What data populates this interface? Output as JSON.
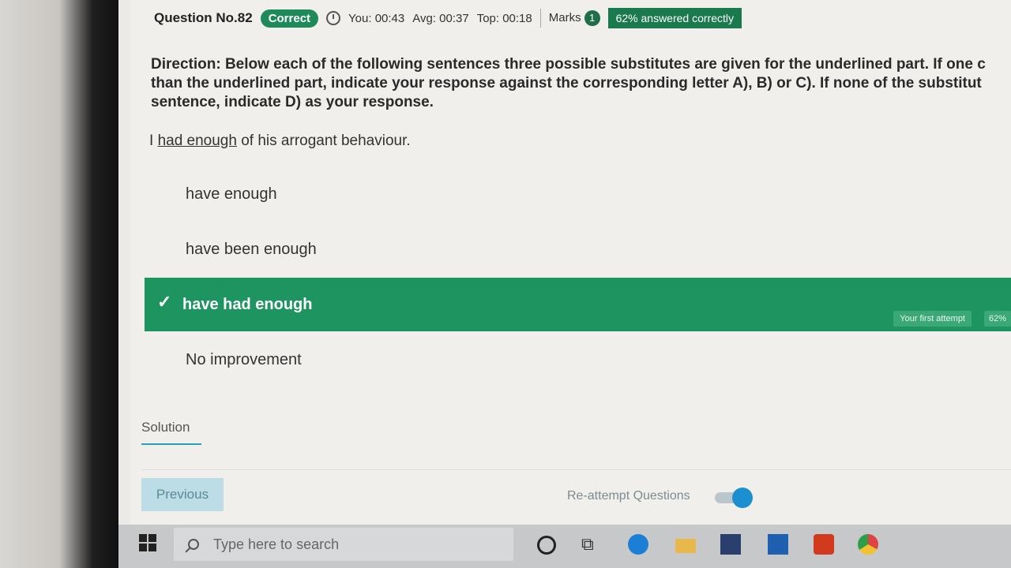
{
  "header": {
    "question_no": "Question No.82",
    "status": "Correct",
    "timing_you": "You: 00:43",
    "timing_avg": "Avg: 00:37",
    "timing_top": "Top: 00:18",
    "marks_label": "Marks",
    "marks_value": "1",
    "answered_pct": "62% answered correctly"
  },
  "question": {
    "direction": "Direction: Below each of the following sentences three possible substitutes are given for the underlined part. If one c",
    "direction_line2": "than the underlined part, indicate your response against the corresponding letter A), B) or C). If none of the substitut",
    "direction_line3": "sentence, indicate D) as your response.",
    "sentence_prefix": "I ",
    "sentence_underlined": "had enough",
    "sentence_suffix": " of his arrogant behaviour."
  },
  "options": [
    {
      "label": "have enough"
    },
    {
      "label": "have been enough"
    },
    {
      "label": "have had enough",
      "first_attempt_tag": "Your first attempt",
      "pct_tag": "62%"
    },
    {
      "label": "No improvement"
    }
  ],
  "tabs": {
    "solution": "Solution"
  },
  "footer": {
    "previous": "Previous",
    "reattempt": "Re-attempt Questions"
  },
  "taskbar": {
    "search_placeholder": "Type here to search"
  },
  "colors": {
    "correct_green": "#1e9460",
    "badge_green": "#1a7a4e",
    "toggle_blue": "#1c8fd0"
  }
}
